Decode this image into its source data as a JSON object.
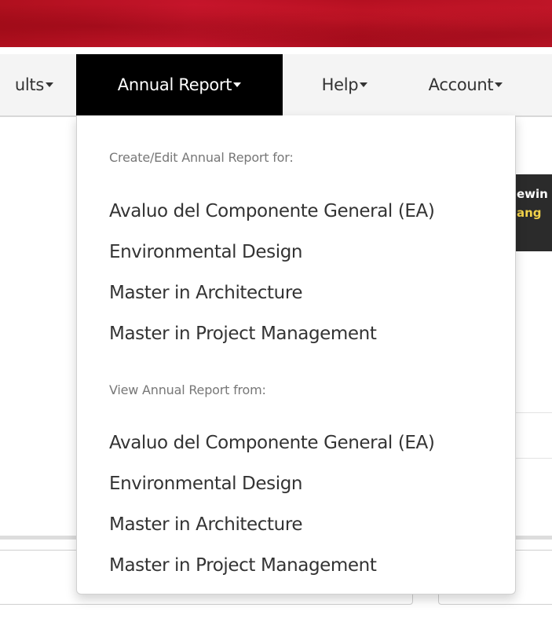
{
  "navbar": {
    "items": [
      {
        "label": "ults",
        "active": false
      },
      {
        "label": "Annual Report",
        "active": true
      },
      {
        "label": "Help",
        "active": false
      },
      {
        "label": "Account",
        "active": false
      }
    ]
  },
  "background": {
    "notice_line1": "ewin",
    "notice_line2": "ang"
  },
  "annual_report_menu": {
    "create_header": "Create/Edit Annual Report for:",
    "create_items": [
      "Avaluo del Componente General (EA)",
      "Environmental Design",
      "Master in Architecture",
      "Master in Project Management"
    ],
    "view_header": "View Annual Report from:",
    "view_items": [
      "Avaluo del Componente General (EA)",
      "Environmental Design",
      "Master in Architecture",
      "Master in Project Management"
    ]
  },
  "colors": {
    "banner_red": "#c4142a",
    "active_tab_bg": "#000000",
    "navbar_bg": "#f4f4f4",
    "notice_highlight": "#f2d24a"
  },
  "icons": {
    "dropdown_caret": "caret-down-icon"
  }
}
